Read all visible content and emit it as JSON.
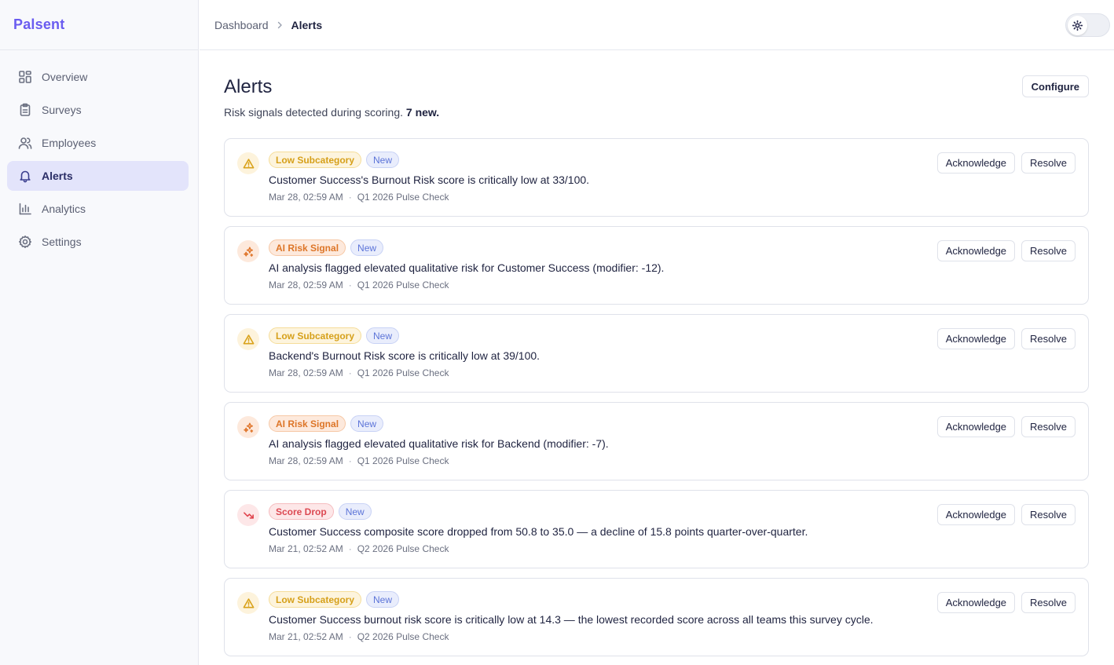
{
  "app": {
    "name": "Palsent"
  },
  "nav": [
    {
      "label": "Overview",
      "icon": "grid-icon"
    },
    {
      "label": "Surveys",
      "icon": "clipboard-icon"
    },
    {
      "label": "Employees",
      "icon": "users-icon"
    },
    {
      "label": "Alerts",
      "icon": "bell-icon",
      "active": true
    },
    {
      "label": "Analytics",
      "icon": "bar-chart-icon"
    },
    {
      "label": "Settings",
      "icon": "gear-icon"
    }
  ],
  "breadcrumb": {
    "parent": "Dashboard",
    "current": "Alerts"
  },
  "page": {
    "title": "Alerts",
    "subtitle": "Risk signals detected during scoring.",
    "new_count": "7 new.",
    "configure_label": "Configure"
  },
  "alerts": [
    {
      "type": "Low Subcategory",
      "kind": "low",
      "badge": "New",
      "message": "Customer Success's Burnout Risk score is critically low at 33/100.",
      "time": "Mar 28, 02:59 AM",
      "survey": "Q1 2026 Pulse Check",
      "ack_label": "Acknowledge",
      "resolve_label": "Resolve"
    },
    {
      "type": "AI Risk Signal",
      "kind": "ai",
      "badge": "New",
      "message": "AI analysis flagged elevated qualitative risk for Customer Success (modifier: -12).",
      "time": "Mar 28, 02:59 AM",
      "survey": "Q1 2026 Pulse Check",
      "ack_label": "Acknowledge",
      "resolve_label": "Resolve"
    },
    {
      "type": "Low Subcategory",
      "kind": "low",
      "badge": "New",
      "message": "Backend's Burnout Risk score is critically low at 39/100.",
      "time": "Mar 28, 02:59 AM",
      "survey": "Q1 2026 Pulse Check",
      "ack_label": "Acknowledge",
      "resolve_label": "Resolve"
    },
    {
      "type": "AI Risk Signal",
      "kind": "ai",
      "badge": "New",
      "message": "AI analysis flagged elevated qualitative risk for Backend (modifier: -7).",
      "time": "Mar 28, 02:59 AM",
      "survey": "Q1 2026 Pulse Check",
      "ack_label": "Acknowledge",
      "resolve_label": "Resolve"
    },
    {
      "type": "Score Drop",
      "kind": "drop",
      "badge": "New",
      "message": "Customer Success composite score dropped from 50.8 to 35.0 — a decline of 15.8 points quarter-over-quarter.",
      "time": "Mar 21, 02:52 AM",
      "survey": "Q2 2026 Pulse Check",
      "ack_label": "Acknowledge",
      "resolve_label": "Resolve"
    },
    {
      "type": "Low Subcategory",
      "kind": "low",
      "badge": "New",
      "message": "Customer Success burnout risk score is critically low at 14.3 — the lowest recorded score across all teams this survey cycle.",
      "time": "Mar 21, 02:52 AM",
      "survey": "Q2 2026 Pulse Check",
      "ack_label": "Acknowledge",
      "resolve_label": "Resolve"
    }
  ],
  "meta_separator": "·",
  "colors": {
    "brand": "#6a5cf0",
    "active_bg": "#e3e4fb",
    "warn": "#d9a21b",
    "ai": "#e0782f",
    "drop": "#e0444d",
    "new": "#5c74d8"
  }
}
